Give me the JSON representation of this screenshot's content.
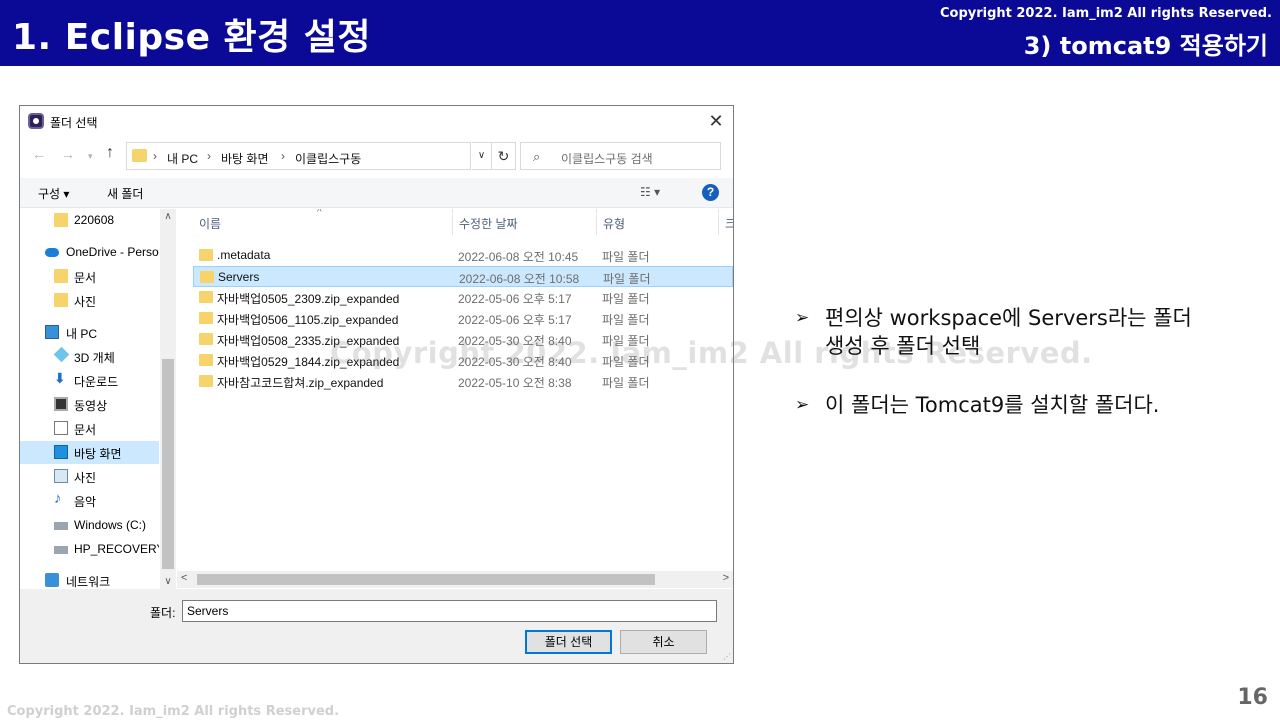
{
  "slide": {
    "title": "1. Eclipse 환경 설정",
    "copyright": "Copyright 2022. Iam_im2 All rights Reserved.",
    "subtitle": "3) tomcat9 적용하기",
    "page_number": "16",
    "footer_copyright": "Copyright 2022. Iam_im2 All rights Reserved.",
    "watermark": "Copyright 2022. Iam_im2 All rights Reserved.",
    "header_color": "#0a0a96"
  },
  "dialog": {
    "title": "폴더 선택",
    "close_glyph": "✕",
    "nav": {
      "back": "←",
      "forward": "→",
      "recent": "▾",
      "up": "↑"
    },
    "breadcrumb": [
      "내 PC",
      "바탕 화면",
      "이클립스구동"
    ],
    "breadcrumb_sep": "›",
    "address_dropdown": "∨",
    "refresh": "↻",
    "search_placeholder": "이클립스구동 검색",
    "toolbar": {
      "organize": "구성 ▾",
      "new_folder": "새 폴더",
      "view": "☷ ▾",
      "help": "?"
    },
    "nav_items": [
      {
        "label": "220608",
        "icon": "folder-icon",
        "icon_class": "ico-folder"
      },
      {
        "label": "OneDrive - Personal",
        "icon": "cloud-icon",
        "icon_class": "ico-cloud"
      },
      {
        "label": "문서",
        "icon": "folder-icon",
        "icon_class": "ico-folder"
      },
      {
        "label": "사진",
        "icon": "folder-icon",
        "icon_class": "ico-folder"
      },
      {
        "label": "내 PC",
        "icon": "pc-icon",
        "icon_class": "ico-pc"
      },
      {
        "label": "3D 개체",
        "icon": "3d-objects-icon",
        "icon_class": "ico-3d"
      },
      {
        "label": "다운로드",
        "icon": "download-icon",
        "icon_class": "ico-download"
      },
      {
        "label": "동영상",
        "icon": "video-icon",
        "icon_class": "ico-video"
      },
      {
        "label": "문서",
        "icon": "document-icon",
        "icon_class": "ico-doc"
      },
      {
        "label": "바탕 화면",
        "icon": "desktop-icon",
        "icon_class": "ico-desktop",
        "selected": true
      },
      {
        "label": "사진",
        "icon": "picture-icon",
        "icon_class": "ico-photo"
      },
      {
        "label": "음악",
        "icon": "music-icon",
        "icon_class": "ico-music"
      },
      {
        "label": "Windows  (C:)",
        "icon": "drive-icon",
        "icon_class": "ico-drive"
      },
      {
        "label": "HP_RECOVERY (",
        "icon": "drive-icon",
        "icon_class": "ico-drive"
      },
      {
        "label": "네트워크",
        "icon": "network-icon",
        "icon_class": "ico-net"
      }
    ],
    "columns": [
      "이름",
      "수정한 날짜",
      "유형",
      "크"
    ],
    "files": [
      {
        "name": ".metadata",
        "date": "2022-06-08 오전 10:45",
        "type": "파일 폴더"
      },
      {
        "name": "Servers",
        "date": "2022-06-08 오전 10:58",
        "type": "파일 폴더",
        "selected": true
      },
      {
        "name": "자바백업0505_2309.zip_expanded",
        "date": "2022-05-06 오후 5:17",
        "type": "파일 폴더"
      },
      {
        "name": "자바백업0506_1105.zip_expanded",
        "date": "2022-05-06 오후 5:17",
        "type": "파일 폴더"
      },
      {
        "name": "자바백업0508_2335.zip_expanded",
        "date": "2022-05-30 오전 8:40",
        "type": "파일 폴더"
      },
      {
        "name": "자바백업0529_1844.zip_expanded",
        "date": "2022-05-30 오전 8:40",
        "type": "파일 폴더"
      },
      {
        "name": "자바참고코드합쳐.zip_expanded",
        "date": "2022-05-10 오전 8:38",
        "type": "파일 폴더"
      }
    ],
    "scroll": {
      "up": "∧",
      "down": "∨",
      "left": "<",
      "right": ">"
    },
    "folder_label": "폴더:",
    "folder_value": "Servers",
    "select_button": "폴더 선택",
    "cancel_button": "취소"
  },
  "bullets": [
    {
      "marker": "➢",
      "lines": [
        "편의상 workspace에 Servers라는 폴더",
        "생성 후 폴더 선택"
      ]
    },
    {
      "marker": "➢",
      "lines": [
        "이 폴더는 Tomcat9를 설치할 폴더다."
      ]
    }
  ]
}
